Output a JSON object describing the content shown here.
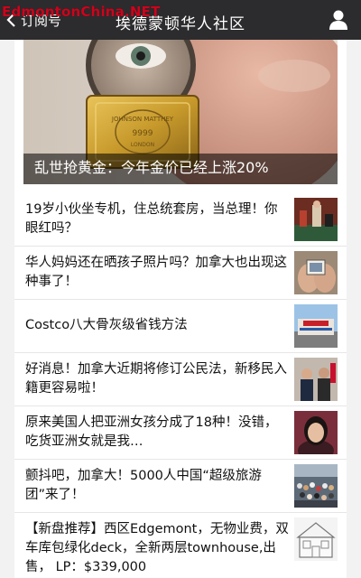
{
  "header": {
    "back_label": "订阅号",
    "title": "埃德蒙顿华人社区",
    "watermark": "EdmontonChina.NET",
    "profile_icon": "person-icon"
  },
  "hero": {
    "caption": "乱世抢黄金：今年金价已经上涨20%",
    "bar_text": "JOHNSON MATTHEY",
    "bar_sub": "9999",
    "bar_city": "LONDON"
  },
  "articles": [
    {
      "title": "19岁小伙坐专机，住总统套房，当总理！你眼红吗？",
      "thumb": "parliament-photo"
    },
    {
      "title": "华人妈妈还在晒孩子照片吗？加拿大也出现这种事了！",
      "thumb": "photos-hands-photo"
    },
    {
      "title": "Costco八大骨灰级省钱方法",
      "thumb": "costco-store-photo"
    },
    {
      "title": "好消息！加拿大近期将修订公民法，新移民入籍更容易啦！",
      "thumb": "citizenship-ceremony-photo"
    },
    {
      "title": "原来美国人把亚洲女孩分成了18种！没错，吃货亚洲女就是我…",
      "thumb": "asian-girl-photo"
    },
    {
      "title": "颤抖吧，加拿大！5000人中国“超级旅游团”来了！",
      "thumb": "tour-group-photo"
    },
    {
      "title": "【新盘推荐】西区Edgemont，无物业费，双车库包绿化deck，全新两层townhouse,出售， LP：$339,000",
      "thumb": "townhouse-photo"
    }
  ]
}
